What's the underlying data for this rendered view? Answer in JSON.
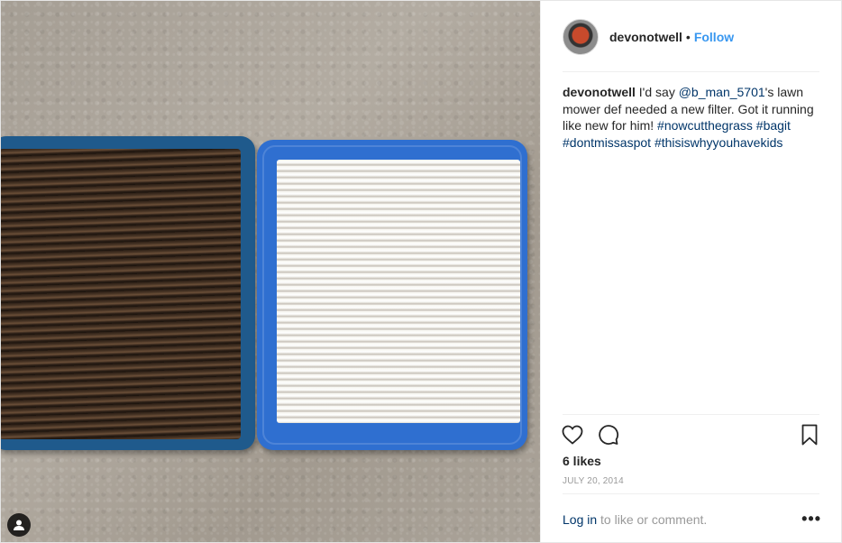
{
  "post": {
    "username": "devonotwell",
    "separator": "•",
    "follow_label": "Follow",
    "caption": {
      "username": "devonotwell",
      "text_1": " I'd say ",
      "mention": "@b_man_5701",
      "text_2": "'s lawn mower def needed a new filter. Got it running like new for him! ",
      "hashtags": [
        "#nowcutthegrass",
        "#bagit",
        "#dontmissaspot",
        "#thisiswhyyouhavekids"
      ]
    },
    "likes": "6 likes",
    "date": "JULY 20, 2014",
    "login_link": "Log in",
    "login_text": " to like or comment.",
    "more_label": "•••"
  },
  "icons": {
    "like": "heart-icon",
    "comment": "comment-icon",
    "save": "bookmark-icon",
    "tag": "user-tag-icon"
  },
  "colors": {
    "link": "#003569",
    "follow": "#3897f0",
    "muted": "#999999",
    "text": "#262626"
  }
}
